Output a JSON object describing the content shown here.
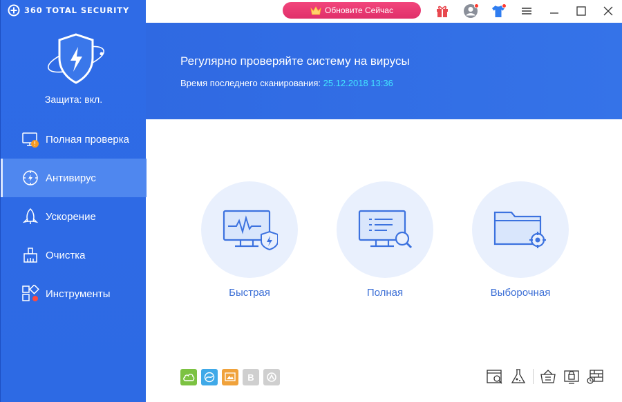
{
  "app": {
    "brand_name": "360 TOTAL SECURITY",
    "protection_status": "Защита: вкл."
  },
  "titlebar": {
    "upgrade_label": "Обновите Сейчас",
    "icons": [
      "gift-icon",
      "account-icon",
      "skin-icon",
      "menu-icon",
      "minimize-icon",
      "maximize-icon",
      "close-icon"
    ]
  },
  "sidebar": {
    "items": [
      {
        "label": "Полная проверка",
        "icon": "monitor-alert-icon",
        "active": false
      },
      {
        "label": "Антивирус",
        "icon": "antivirus-icon",
        "active": true
      },
      {
        "label": "Ускорение",
        "icon": "rocket-icon",
        "active": false
      },
      {
        "label": "Очистка",
        "icon": "broom-icon",
        "active": false
      },
      {
        "label": "Инструменты",
        "icon": "tools-grid-icon",
        "active": false
      }
    ]
  },
  "banner": {
    "title": "Регулярно проверяйте систему на вирусы",
    "last_scan_label": "Время последнего сканирования: ",
    "last_scan_value": "25.12.2018 13:36"
  },
  "scans": [
    {
      "label": "Быстрая",
      "icon": "quick-scan-icon"
    },
    {
      "label": "Полная",
      "icon": "full-scan-icon"
    },
    {
      "label": "Выборочная",
      "icon": "custom-scan-icon"
    }
  ],
  "plugins": [
    {
      "icon": "cloud-engine-icon",
      "color": "#7cc242"
    },
    {
      "icon": "qvm-engine-icon",
      "color": "#3fa9e8"
    },
    {
      "icon": "system-repair-icon",
      "color": "#f0a23b"
    },
    {
      "icon": "bitdefender-icon",
      "color": "#cfcfcf",
      "letter": "B"
    },
    {
      "icon": "avira-icon",
      "color": "#cfcfcf"
    }
  ],
  "tools": [
    "quarantine-icon",
    "sandbox-icon",
    "trusted-list-icon",
    "protection-icon",
    "firewall-icon"
  ],
  "colors": {
    "sidebar": "#2f6be6",
    "banner": "#3170e6",
    "accent_text": "#3c6fd6",
    "date": "#43e6ff",
    "upgrade": "#e8356f"
  }
}
